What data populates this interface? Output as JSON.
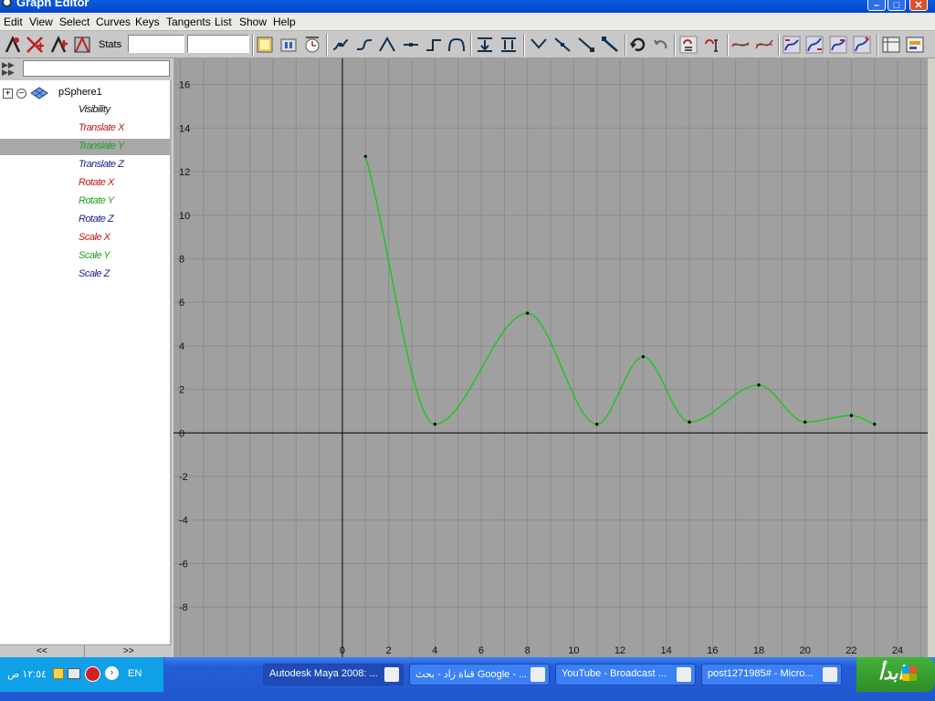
{
  "window": {
    "title": "Graph Editor"
  },
  "menu": [
    "Edit",
    "View",
    "Select",
    "Curves",
    "Keys",
    "Tangents",
    "List",
    "Show",
    "Help"
  ],
  "toolbar": {
    "stats_label": "Stats",
    "stats_value_1": "",
    "stats_value_2": ""
  },
  "outliner": {
    "filter_value": "",
    "node_name": "pSphere1",
    "attributes": [
      {
        "label": "Visibility",
        "color": "#111111",
        "selected": false
      },
      {
        "label": "Translate X",
        "color": "#c01818",
        "selected": false
      },
      {
        "label": "Translate Y",
        "color": "#1aa01a",
        "selected": true
      },
      {
        "label": "Translate Z",
        "color": "#1c1c8c",
        "selected": false
      },
      {
        "label": "Rotate X",
        "color": "#c01818",
        "selected": false
      },
      {
        "label": "Rotate Y",
        "color": "#1aa01a",
        "selected": false
      },
      {
        "label": "Rotate Z",
        "color": "#1c1c8c",
        "selected": false
      },
      {
        "label": "Scale X",
        "color": "#c01818",
        "selected": false
      },
      {
        "label": "Scale Y",
        "color": "#1aa01a",
        "selected": false
      },
      {
        "label": "Scale Z",
        "color": "#1c1c8c",
        "selected": false
      }
    ],
    "scroll_left": "<<",
    "scroll_right": ">>"
  },
  "chart_data": {
    "type": "line",
    "xlim": [
      -7.3,
      25.3
    ],
    "ylim": [
      -10.3,
      17.2
    ],
    "x_ticks": [
      0,
      2,
      4,
      6,
      8,
      10,
      12,
      14,
      16,
      18,
      20,
      22,
      24
    ],
    "y_ticks": [
      -8,
      -6,
      -4,
      -2,
      0,
      2,
      4,
      6,
      8,
      10,
      12,
      14,
      16
    ],
    "grid": true,
    "background": "#a0a0a0",
    "grid_color": "#8c8c8c",
    "curve_color": "#00d000",
    "series": [
      {
        "attribute": "Translate Y",
        "keys": [
          {
            "x": 1,
            "y": 12.7
          },
          {
            "x": 4,
            "y": 0.4
          },
          {
            "x": 8,
            "y": 5.5
          },
          {
            "x": 11,
            "y": 0.4
          },
          {
            "x": 13,
            "y": 3.5
          },
          {
            "x": 15,
            "y": 0.5
          },
          {
            "x": 18,
            "y": 2.2
          },
          {
            "x": 20,
            "y": 0.5
          },
          {
            "x": 22,
            "y": 0.8
          },
          {
            "x": 23,
            "y": 0.4
          }
        ]
      }
    ]
  },
  "taskbar": {
    "start_label": "ابدأ",
    "tasks": [
      {
        "label": "Autodesk Maya 2008: ...",
        "active": true
      },
      {
        "label": "قناة زاد - بحث Google - ...",
        "active": false
      },
      {
        "label": "YouTube - Broadcast ...",
        "active": false
      },
      {
        "label": "post1271985# - Micro...",
        "active": false
      }
    ],
    "language": "EN",
    "clock": "١٢:٥٤ ص"
  }
}
